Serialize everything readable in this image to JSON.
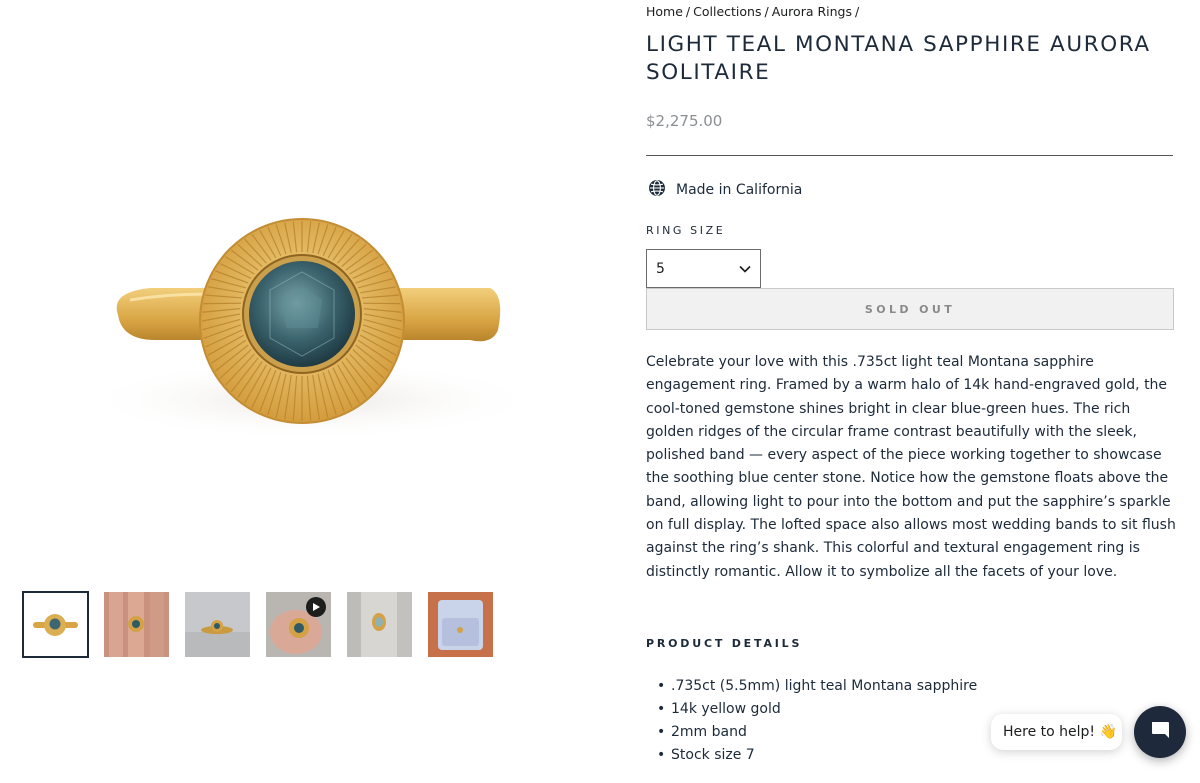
{
  "breadcrumb": {
    "home": "Home",
    "collections": "Collections",
    "aurora": "Aurora Rings",
    "sep": "/"
  },
  "product": {
    "title": "LIGHT TEAL MONTANA SAPPHIRE AURORA SOLITAIRE",
    "price": "$2,275.00",
    "origin": "Made in California",
    "ring_size_label": "RING SIZE",
    "ring_size_value": "5",
    "sold_out_label": "SOLD OUT",
    "description": "Celebrate your love with this .735ct light teal Montana sapphire engagement ring. Framed by a warm halo of 14k hand-engraved gold, the cool-toned gemstone shines bright in clear blue-green hues. The rich golden ridges of the circular frame contrast beautifully with the sleek, polished band — every aspect of the piece working together to showcase the soothing blue center stone. Notice how the gemstone floats above the band, allowing light to pour into the bottom and put the sapphire’s sparkle on full display. The lofted space also allows most wedding bands to sit flush against the ring’s shank. This colorful and textural engagement ring is distinctly romantic. Allow it to symbolize all the facets of your love.",
    "details_heading": "PRODUCT DETAILS",
    "details": [
      ".735ct (5.5mm) light teal Montana sapphire",
      "14k yellow gold",
      "2mm band",
      "Stock size 7"
    ]
  },
  "chat": {
    "prompt": "Here to help! 👋"
  },
  "colors": {
    "gold": "#d9a94a",
    "stone": "#3f6a73",
    "navy": "#1e2a3b"
  }
}
